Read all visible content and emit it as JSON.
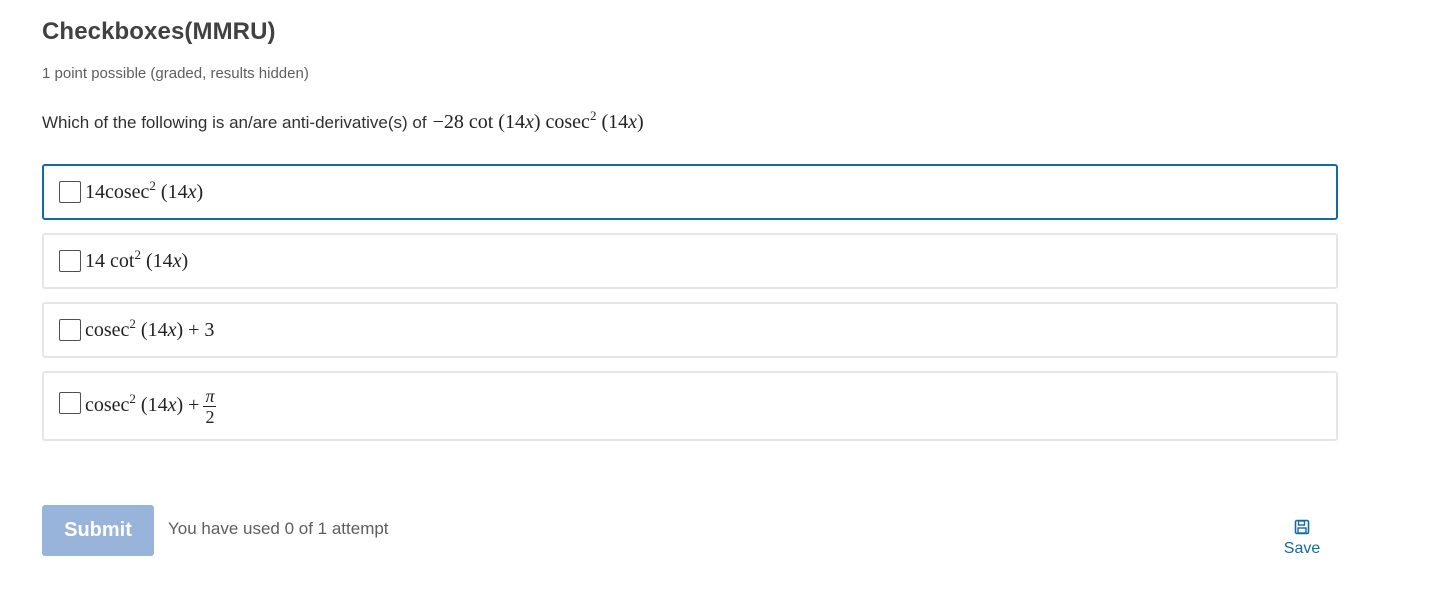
{
  "problem": {
    "title": "Checkboxes(MMRU)",
    "points": "1 point possible (graded, results hidden)",
    "question_text": "Which of the following is an/are anti-derivative(s) of",
    "question_math": {
      "coef": "−28",
      "f1": "cot",
      "arg1": "(14",
      "x1": "x",
      "close1": ")",
      "f2": "cosec",
      "exp": "2",
      "arg2": "(14",
      "x2": "x",
      "close2": ")"
    },
    "choices": [
      {
        "pre": "14cosec",
        "exp": "2",
        "arg": "(14",
        "x": "x",
        "post": ")",
        "checked": false,
        "focused": true
      },
      {
        "pre": "14 cot",
        "exp": "2",
        "arg": "(14",
        "x": "x",
        "post": ")",
        "checked": false,
        "focused": false
      },
      {
        "pre": "cosec",
        "exp": "2",
        "arg": "(14",
        "x": "x",
        "post": ") + 3",
        "checked": false,
        "focused": false
      },
      {
        "pre": "cosec",
        "exp": "2",
        "arg": "(14",
        "x": "x",
        "post": ") +",
        "frac_num": "π",
        "frac_den": "2",
        "checked": false,
        "focused": false
      }
    ]
  },
  "actions": {
    "submit_label": "Submit",
    "attempts_text": "You have used 0 of 1 attempt",
    "save_label": "Save",
    "save_icon": "floppy-disk-icon"
  },
  "colors": {
    "accent": "#0f6ba2",
    "submit_disabled_bg": "#98b4da",
    "border": "#e6e6e6"
  }
}
